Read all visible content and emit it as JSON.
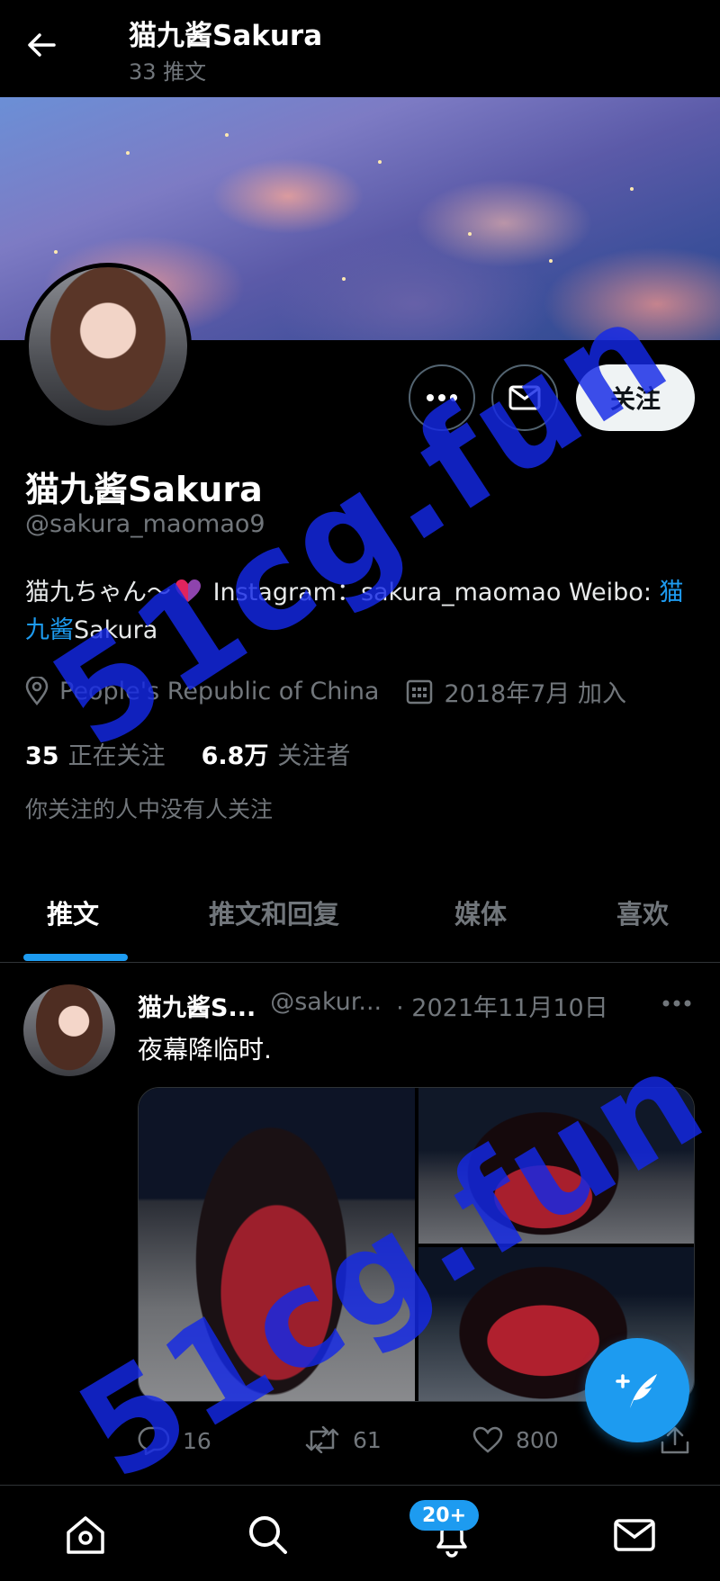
{
  "header": {
    "title": "猫九酱Sakura",
    "subtitle": "33 推文"
  },
  "profile": {
    "name": "猫九酱Sakura",
    "handle": "@sakura_maomao9",
    "bio_part1": "猫九ちゃん～",
    "bio_part2": " Instagram：sakura_maomao Weibo: ",
    "bio_link": "猫九酱",
    "bio_part3": "Sakura",
    "location": "People's Republic of China",
    "joined": "2018年7月 加入",
    "following_count": "35",
    "following_label": "正在关注",
    "followers_count": "6.8万",
    "followers_label": "关注者",
    "followed_by_note": "你关注的人中没有人关注",
    "follow_button": "关注"
  },
  "tabs": [
    {
      "label": "推文",
      "active": true
    },
    {
      "label": "推文和回复",
      "active": false
    },
    {
      "label": "媒体",
      "active": false
    },
    {
      "label": "喜欢",
      "active": false
    }
  ],
  "tweet": {
    "name": "猫九酱S...",
    "handle": "@sakur...",
    "date": "· 2021年11月10日",
    "text": "夜幕降临时.",
    "replies": "16",
    "retweets": "61",
    "likes": "800"
  },
  "bottom_nav": {
    "notifications_badge": "20+",
    "items": [
      "home-icon",
      "search-icon",
      "notifications-icon",
      "messages-icon"
    ]
  },
  "watermark": {
    "text1": "51cg.fun",
    "text2": "51cg.fun"
  },
  "colors": {
    "accent": "#1d9bf0",
    "background": "#000000",
    "secondary_text": "#71767b",
    "watermark": "#1428e6"
  }
}
